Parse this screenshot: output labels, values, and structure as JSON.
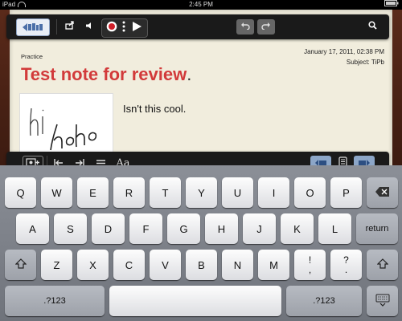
{
  "status_bar": {
    "device": "iPad",
    "time": "2:45 PM"
  },
  "toolbar_top": {
    "icons": [
      "notebooks-icon",
      "share-icon",
      "speaker-icon",
      "record-icon",
      "more-icon",
      "play-icon",
      "undo-icon",
      "redo-icon",
      "search-icon"
    ]
  },
  "note": {
    "category": "Practice",
    "date": "January 17, 2011, 02:38 PM",
    "subject": "Subject: TiPb",
    "title": "Test note for review",
    "title_period": ".",
    "body": "Isn't this cool."
  },
  "toolbar_bottom": {
    "font_label": "Aa",
    "icons": [
      "insert-media-icon",
      "outdent-icon",
      "indent-icon",
      "list-icon",
      "font-icon",
      "page-prev-icon",
      "page-icon",
      "page-next-icon"
    ]
  },
  "keyboard": {
    "row1": [
      "Q",
      "W",
      "E",
      "R",
      "T",
      "Y",
      "U",
      "I",
      "O",
      "P"
    ],
    "row2": [
      "A",
      "S",
      "D",
      "F",
      "G",
      "H",
      "J",
      "K",
      "L"
    ],
    "row3": [
      "Z",
      "X",
      "C",
      "V",
      "B",
      "N",
      "M"
    ],
    "return_label": "return",
    "symbols_label": ".?123",
    "punct1": [
      "!",
      ","
    ],
    "punct2": [
      "?",
      "."
    ]
  }
}
